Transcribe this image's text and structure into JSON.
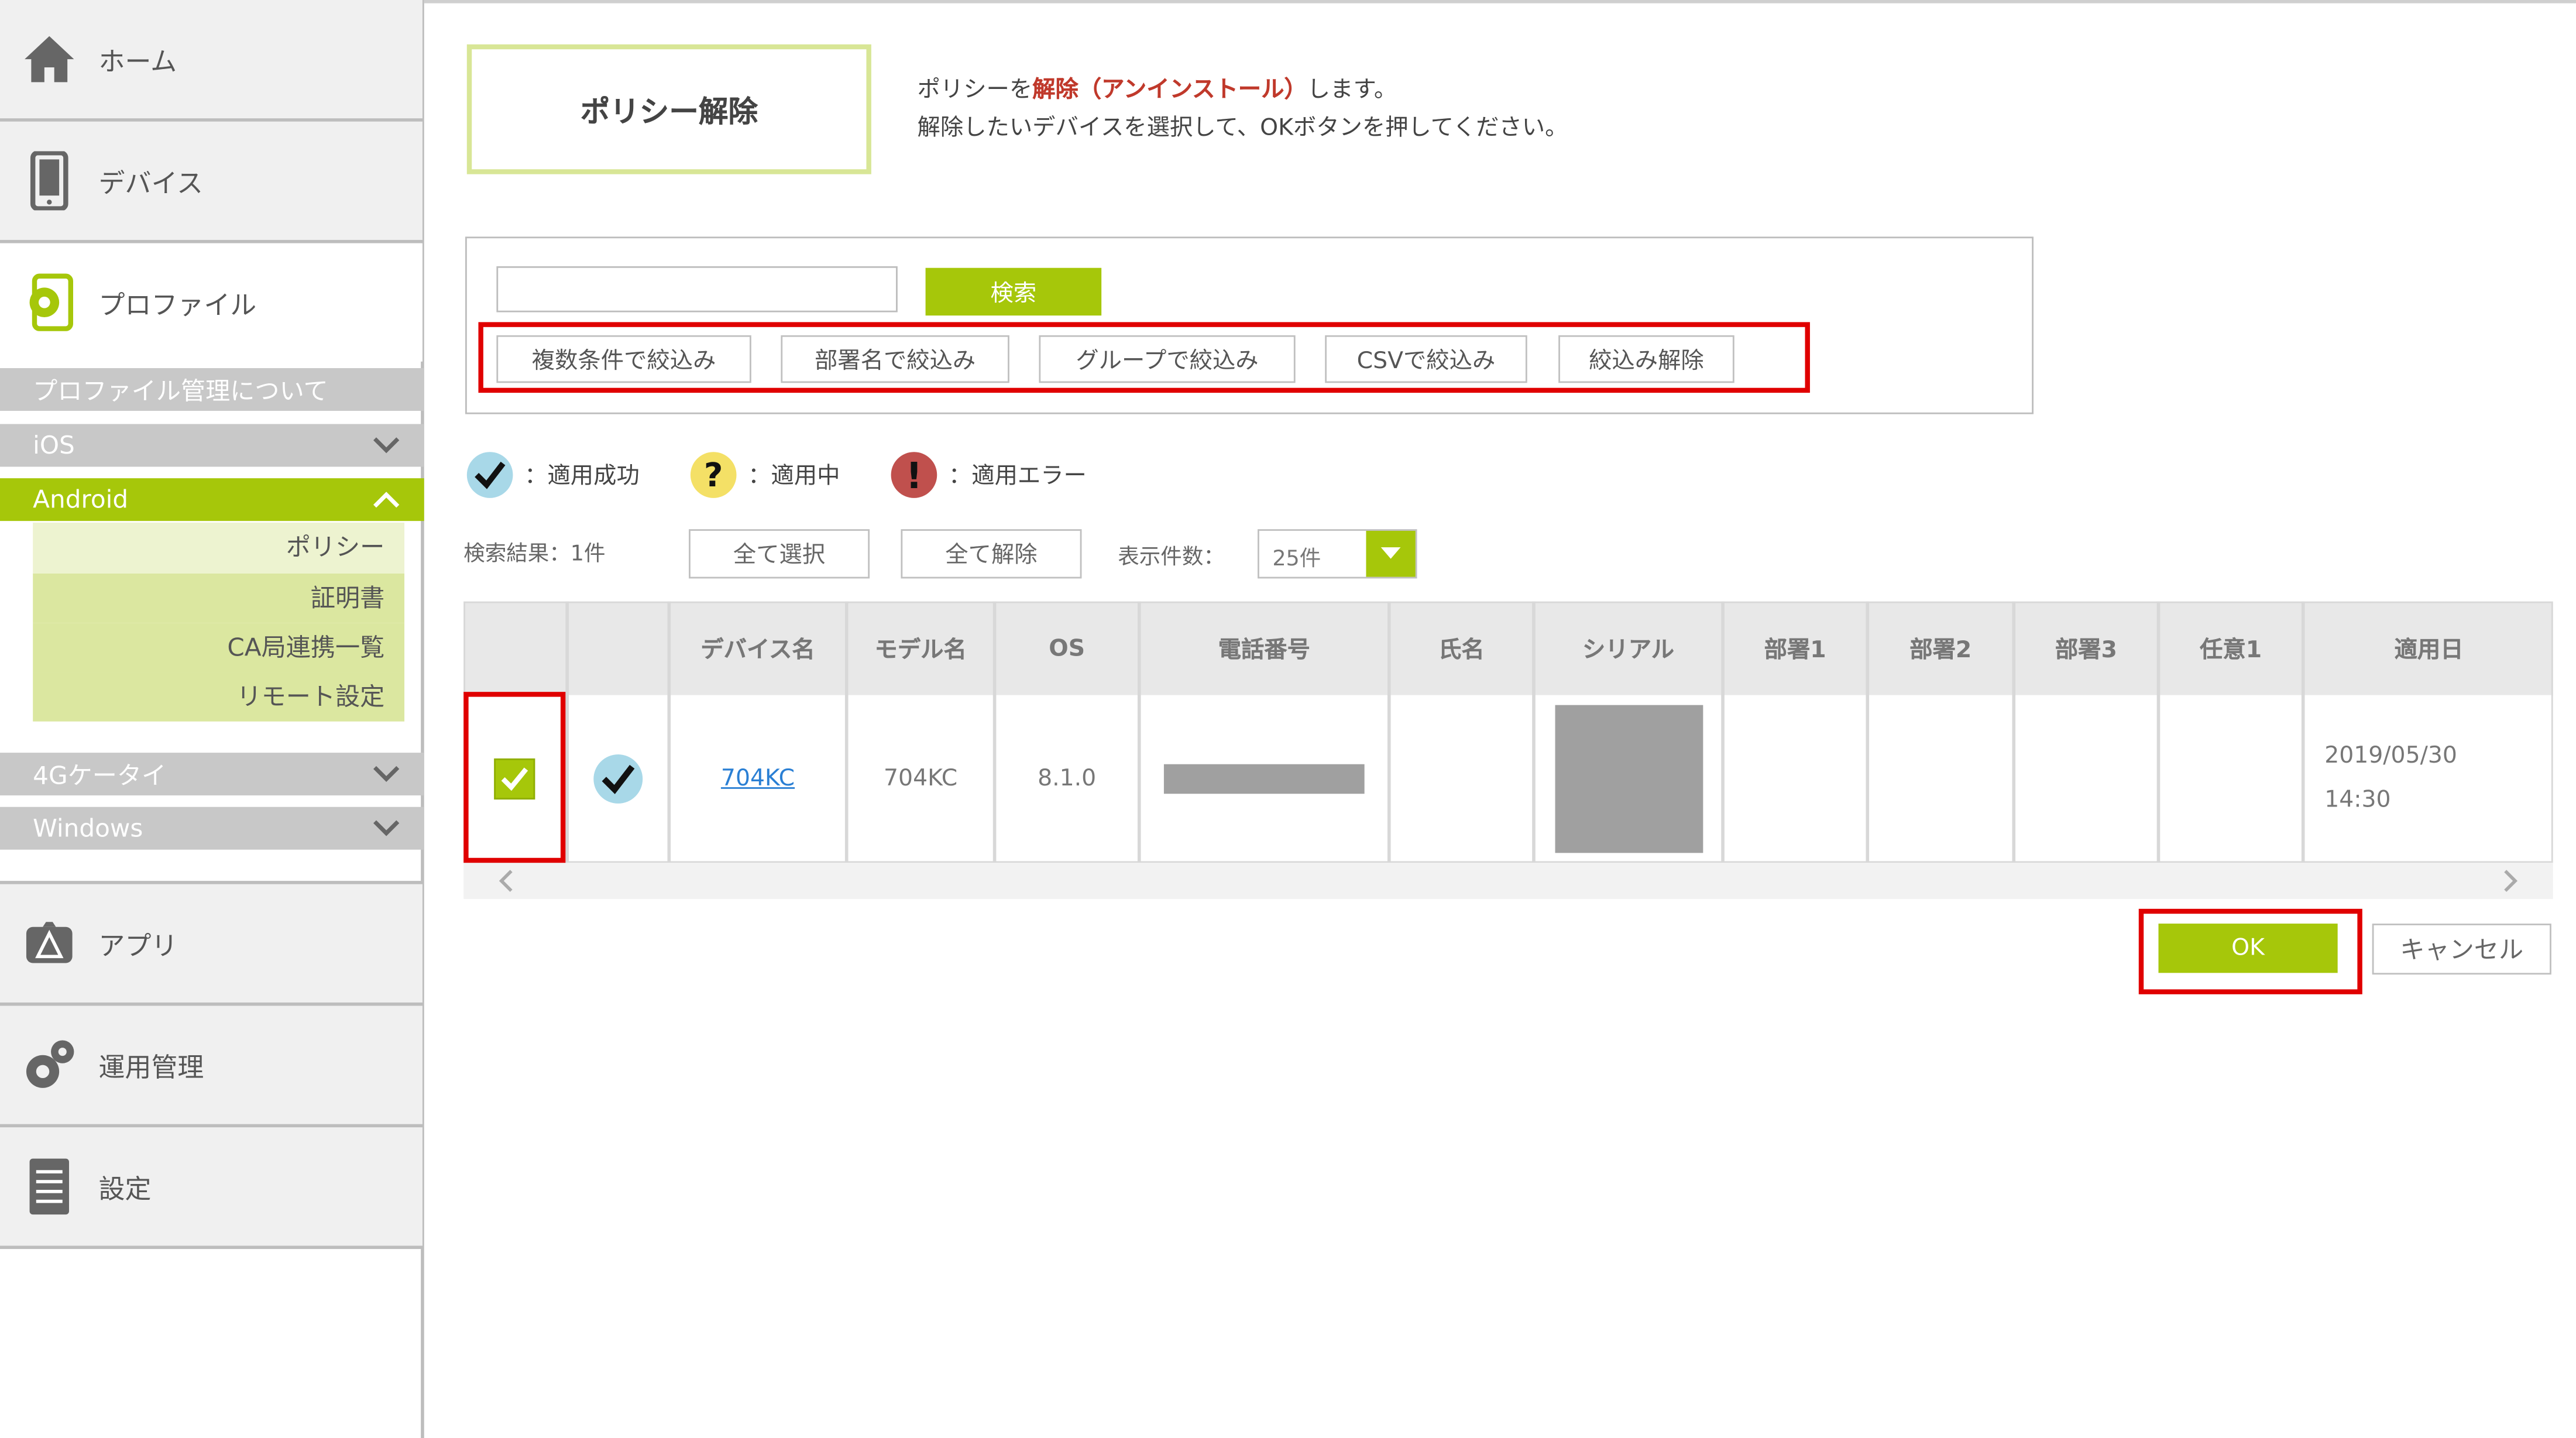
{
  "sidebar": {
    "home": "ホーム",
    "device": "デバイス",
    "profile": "プロファイル",
    "profile_about": "プロファイル管理について",
    "ios": "iOS",
    "android": "Android",
    "android_items": [
      "ポリシー",
      "証明書",
      "CA局連携一覧",
      "リモート設定"
    ],
    "kei4g": "4Gケータイ",
    "windows": "Windows",
    "app": "アプリ",
    "operation": "運用管理",
    "settings": "設定"
  },
  "header": {
    "title": "ポリシー解除",
    "desc_line1_pre": "ポリシーを",
    "desc_line1_red": "解除（アンインストール）",
    "desc_line1_post": "します。",
    "desc_line2": "解除したいデバイスを選択して、OKボタンを押してください。"
  },
  "search": {
    "input_value": "",
    "button": "検索",
    "filters": [
      "複数条件で絞込み",
      "部署名で絞込み",
      "グループで絞込み",
      "CSVで絞込み",
      "絞込み解除"
    ]
  },
  "legend": {
    "success": "：適用成功",
    "pending": "：適用中",
    "error": "：適用エラー"
  },
  "toolbar": {
    "result": "検索結果：1件",
    "select_all": "全て選択",
    "deselect_all": "全て解除",
    "per_page_label": "表示件数：",
    "per_page_value": "25件"
  },
  "table": {
    "headers": [
      "デバイス名",
      "モデル名",
      "OS",
      "電話番号",
      "氏名",
      "シリアル",
      "部署1",
      "部署2",
      "部署3",
      "任意1",
      "適用日"
    ],
    "row": {
      "device_name": "704KC",
      "model": "704KC",
      "os": "8.1.0",
      "date": "2019/05/30",
      "time": "14:30"
    }
  },
  "actions": {
    "ok": "OK",
    "cancel": "キャンセル"
  },
  "colors": {
    "accent_green": "#a6c70a",
    "highlight_red": "#e00000"
  }
}
